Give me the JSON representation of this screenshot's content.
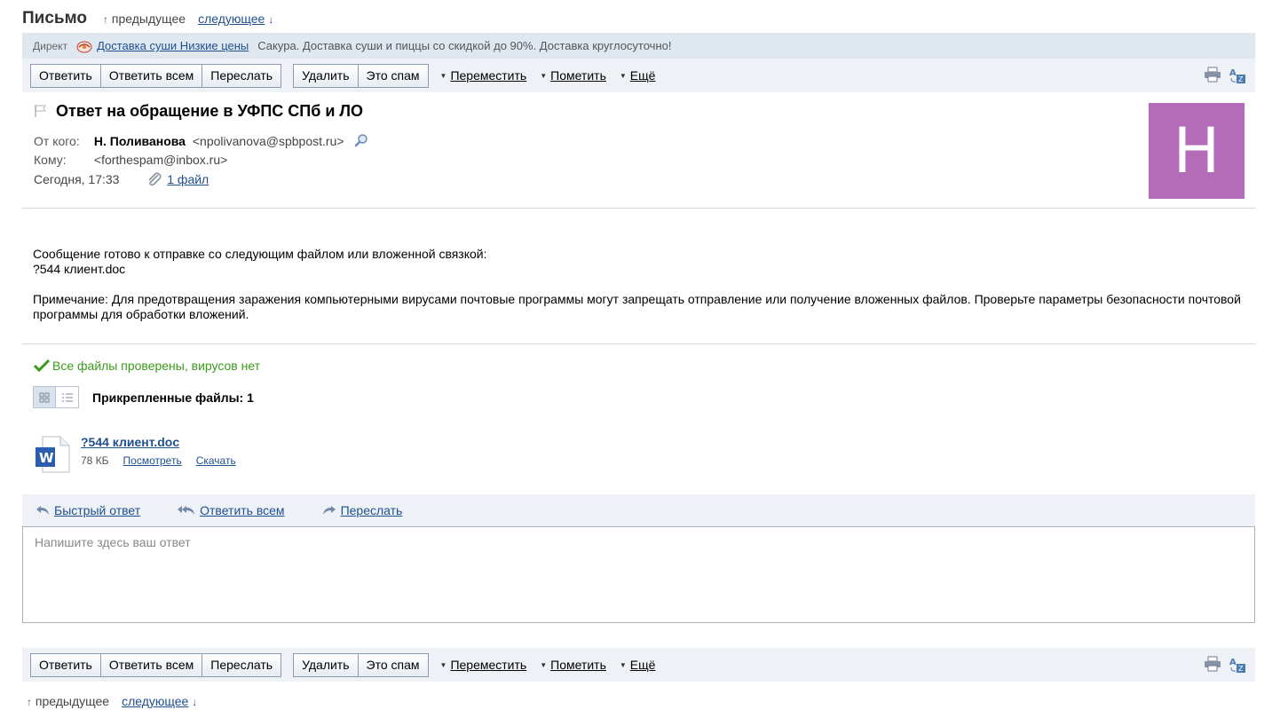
{
  "header": {
    "title": "Письмо",
    "prev_label": "предыдущее",
    "next_label": "следующее"
  },
  "ad": {
    "label": "Директ",
    "link_text": "Доставка суши Низкие цены",
    "text": "Сакура. Доставка суши и пиццы со скидкой до 90%. Доставка круглосуточно!"
  },
  "toolbar": {
    "reply": "Ответить",
    "reply_all": "Ответить всем",
    "forward": "Переслать",
    "delete": "Удалить",
    "spam": "Это спам",
    "move": "Переместить",
    "mark": "Пометить",
    "more": "Ещё"
  },
  "message": {
    "subject": "Ответ на обращение в УФПС СПб и ЛО",
    "from_label": "От кого:",
    "from_name": "Н. Поливанова",
    "from_email": "<npolivanova@spbpost.ru>",
    "to_label": "Кому:",
    "to_email": "<forthespam@inbox.ru>",
    "date": "Сегодня, 17:33",
    "attachments_link": "1 файл",
    "avatar_letter": "Н",
    "avatar_color": "#b56cb8"
  },
  "body": {
    "line1": "Сообщение готово к отправке со следующим файлом или вложенной связкой:",
    "line2": "?544 клиент.doc",
    "note": "Примечание: Для предотвращения заражения компьютерными вирусами почтовые программы могут запрещать отправление или получение вложенных файлов.  Проверьте параметры безопасности почтовой программы для обработки вложений."
  },
  "attachments": {
    "virus_status": "Все файлы проверены, вирусов нет",
    "title": "Прикрепленные файлы: 1",
    "file": {
      "name": "?544 клиент.doc",
      "size": "78 КБ",
      "view": "Посмотреть",
      "download": "Скачать"
    }
  },
  "quick_reply": {
    "fast_reply": "Быстрый ответ",
    "reply_all": "Ответить всем",
    "forward": "Переслать",
    "placeholder": "Напишите здесь ваш ответ"
  },
  "colors": {
    "accent_link": "#1f4f8e",
    "virus_ok": "#3a9b1a",
    "toolbar_bg": "#eef2f7"
  }
}
